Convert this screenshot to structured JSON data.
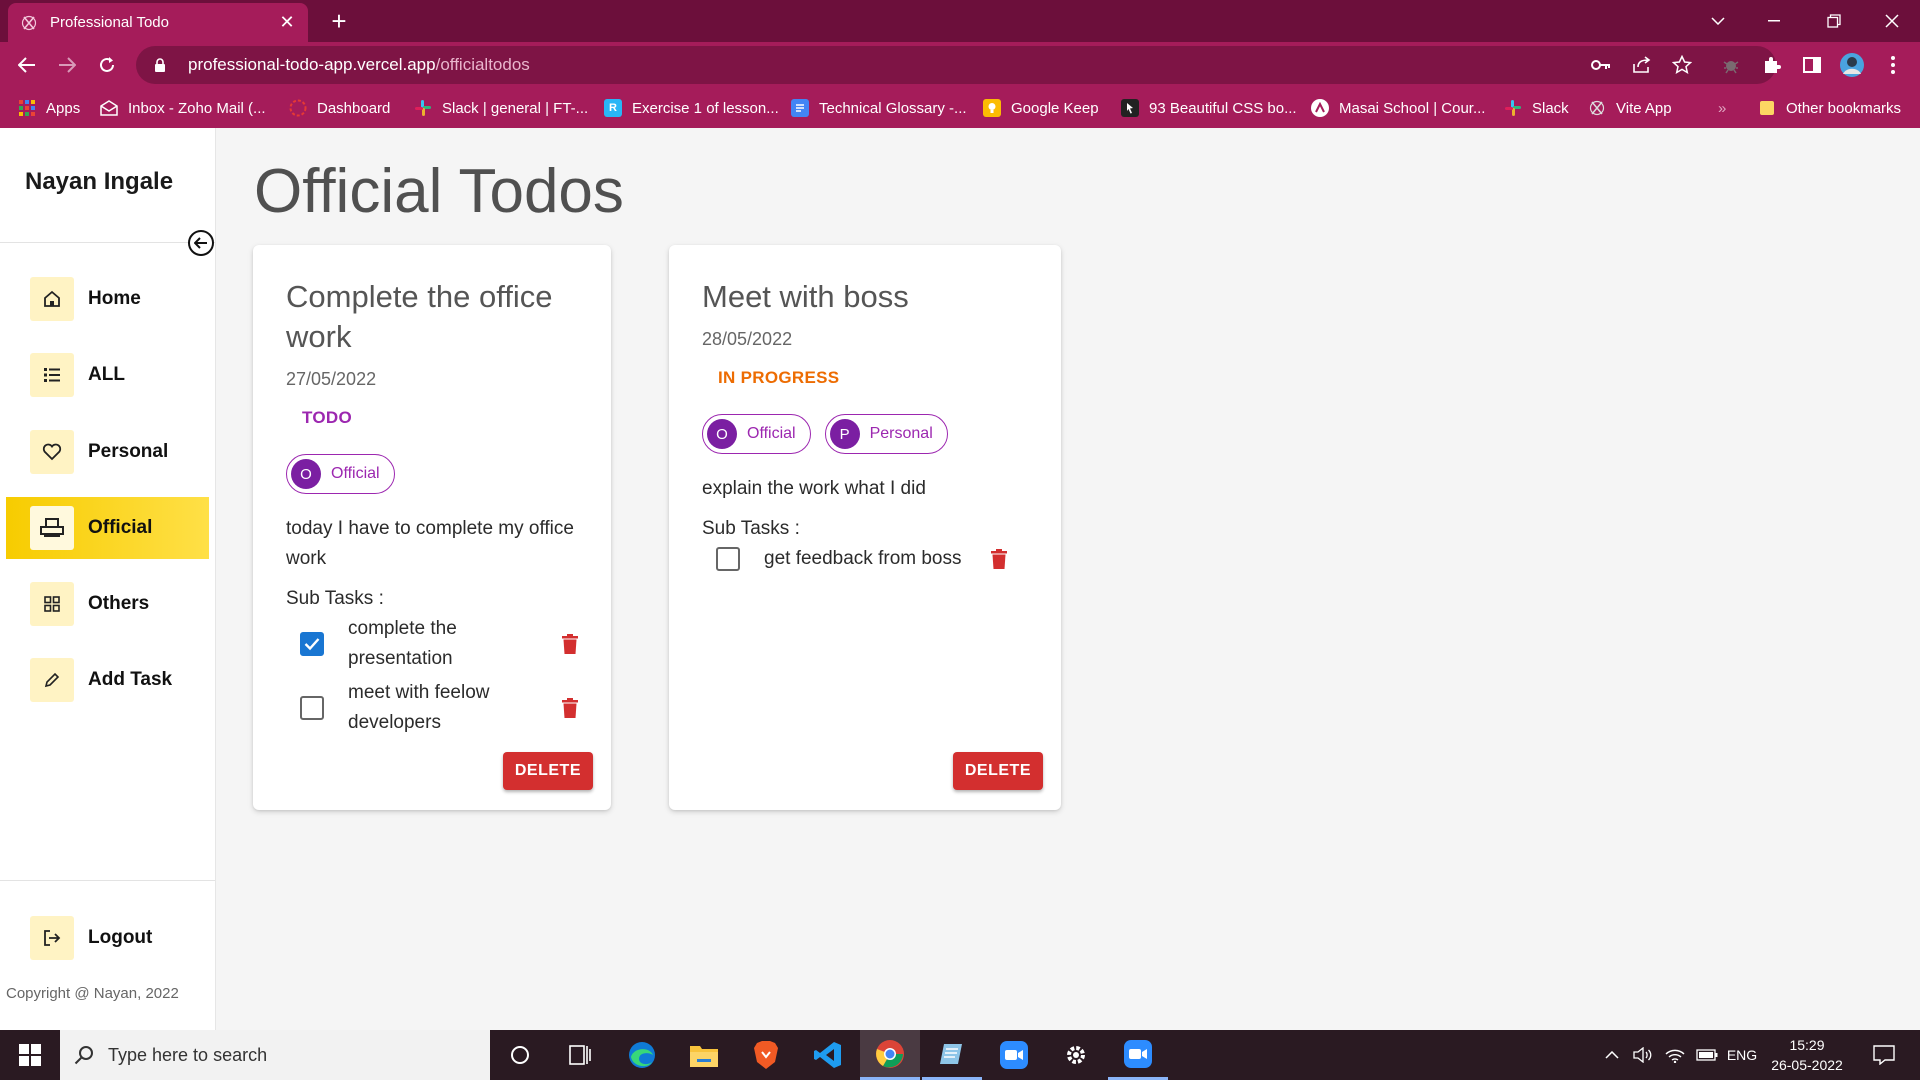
{
  "browser": {
    "tab_title": "Professional Todo",
    "tab_close": "✕",
    "new_tab": "+",
    "url_host": "professional-todo-app.vercel.app",
    "url_path": "/officialtodos",
    "bookmarks": [
      {
        "label": "Apps",
        "icon": "apps-grid-icon",
        "color": "#4285f4"
      },
      {
        "label": "Inbox - Zoho Mail (...",
        "icon": "zoho-mail-icon",
        "color": "#e8e8e8"
      },
      {
        "label": "Dashboard",
        "icon": "dashboard-icon",
        "color": "#e53935"
      },
      {
        "label": "Slack | general | FT-...",
        "icon": "slack-icon",
        "color": "#e01e5a"
      },
      {
        "label": "Exercise 1 of lesson...",
        "icon": "exercise-icon",
        "color": "#29b6f6"
      },
      {
        "label": "Technical Glossary -...",
        "icon": "docs-icon",
        "color": "#4285f4"
      },
      {
        "label": "Google Keep",
        "icon": "google-keep-icon",
        "color": "#fbbc04"
      },
      {
        "label": "93 Beautiful CSS bo...",
        "icon": "css-icon",
        "color": "#222222"
      },
      {
        "label": "Masai School | Cour...",
        "icon": "masai-icon",
        "color": "#ffffff"
      },
      {
        "label": "Slack",
        "icon": "slack-icon",
        "color": "#e01e5a"
      },
      {
        "label": "Vite App",
        "icon": "vite-icon",
        "color": "#cccccc"
      },
      {
        "label": "Other bookmarks",
        "icon": "folder-icon",
        "color": "#fdd663"
      }
    ],
    "bookmarks_overflow": "»"
  },
  "sidebar": {
    "user_name": "Nayan Ingale",
    "items": [
      {
        "label": "Home",
        "icon": "home-icon"
      },
      {
        "label": "ALL",
        "icon": "list-icon"
      },
      {
        "label": "Personal",
        "icon": "heart-icon"
      },
      {
        "label": "Official",
        "icon": "printer-icon",
        "active": true
      },
      {
        "label": "Others",
        "icon": "grid-icon"
      },
      {
        "label": "Add Task",
        "icon": "pencil-icon"
      }
    ],
    "logout_label": "Logout",
    "copyright": "Copyright @ Nayan, 2022"
  },
  "main": {
    "title": "Official Todos",
    "cards": [
      {
        "title": "Complete the office work",
        "date": "27/05/2022",
        "status": "TODO",
        "tags": [
          {
            "initial": "O",
            "label": "Official"
          }
        ],
        "description": "today I have to complete my office work",
        "subtasks_label": "Sub Tasks :",
        "subtasks": [
          {
            "text": "complete the presentation",
            "done": true
          },
          {
            "text": "meet with feelow developers",
            "done": false
          }
        ],
        "delete_label": "DELETE"
      },
      {
        "title": "Meet with boss",
        "date": "28/05/2022",
        "status": "IN PROGRESS",
        "tags": [
          {
            "initial": "O",
            "label": "Official"
          },
          {
            "initial": "P",
            "label": "Personal"
          }
        ],
        "description": "explain the work what I did",
        "subtasks_label": "Sub Tasks :",
        "subtasks": [
          {
            "text": "get feedback from boss",
            "done": false
          }
        ],
        "delete_label": "DELETE"
      }
    ]
  },
  "taskbar": {
    "search_placeholder": "Type here to search",
    "language": "ENG",
    "time": "15:29",
    "date": "26-05-2022"
  },
  "colors": {
    "brand": "#a51c5a",
    "active_nav": "#ffd600",
    "chip": "#9c27b0",
    "delete": "#d32f2f",
    "status_todo": "#9c27b0",
    "status_progress": "#ed6c02"
  }
}
